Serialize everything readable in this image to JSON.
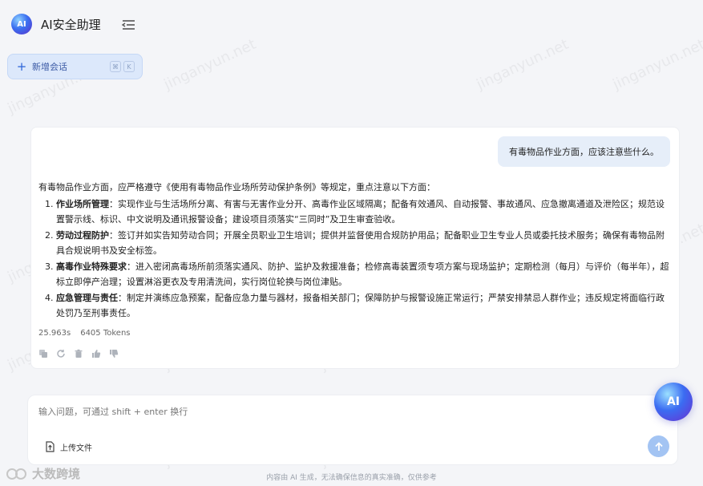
{
  "app": {
    "title": "AI安全助理",
    "logo_text": "AI"
  },
  "sidebar": {
    "new_chat_label": "新增会话",
    "shortcut_keys": [
      "⌘",
      "K"
    ]
  },
  "conversation": {
    "user_message": "有毒物品作业方面，应该注意些什么。",
    "answer_intro": "有毒物品作业方面，应严格遵守《使用有毒物品作业场所劳动保护条例》等规定，重点注意以下方面：",
    "answer_items": [
      {
        "title": "作业场所管理",
        "sep": "：",
        "text": "实现作业与生活场所分离、有害与无害作业分开、高毒作业区域隔离；配备有效通风、自动报警、事故通风、应急撤离通道及泄险区；规范设置警示线、标识、中文说明及通讯报警设备；建设项目须落实“三同时”及卫生审查验收。"
      },
      {
        "title": "劳动过程防护",
        "sep": "：",
        "text": "签订并如实告知劳动合同；开展全员职业卫生培训；提供并监督使用合规防护用品；配备职业卫生专业人员或委托技术服务；确保有毒物品附具合规说明书及安全标签。"
      },
      {
        "title": "高毒作业特殊要求",
        "sep": "：",
        "text": "进入密闭高毒场所前须落实通风、防护、监护及救援准备；检修高毒装置须专项方案与现场监护；定期检测（每月）与评价（每半年），超标立即停产治理；设置淋浴更衣及专用清洗间，实行岗位轮换与岗位津贴。"
      },
      {
        "title": "应急管理与责任",
        "sep": "：",
        "text": "制定并演练应急预案，配备应急力量与器材，报备相关部门；保障防护与报警设施正常运行；严禁安排禁忌人群作业；违反规定将面临行政处罚乃至刑事责任。"
      }
    ],
    "duration": "25.963s",
    "tokens": "6405 Tokens"
  },
  "input": {
    "placeholder": "输入问题，可通过 shift + enter 换行",
    "upload_label": "上传文件"
  },
  "float_button_text": "AI",
  "footer_note": "内容由 AI 生成，无法确保信息的真实准确，仅供参考",
  "corner_brand": "大数跨境",
  "watermark_text": "jinganyun.net",
  "colors": {
    "accent": "#2a63d8",
    "send_button": "#a3c4f3",
    "user_bubble": "#e6eef9"
  }
}
